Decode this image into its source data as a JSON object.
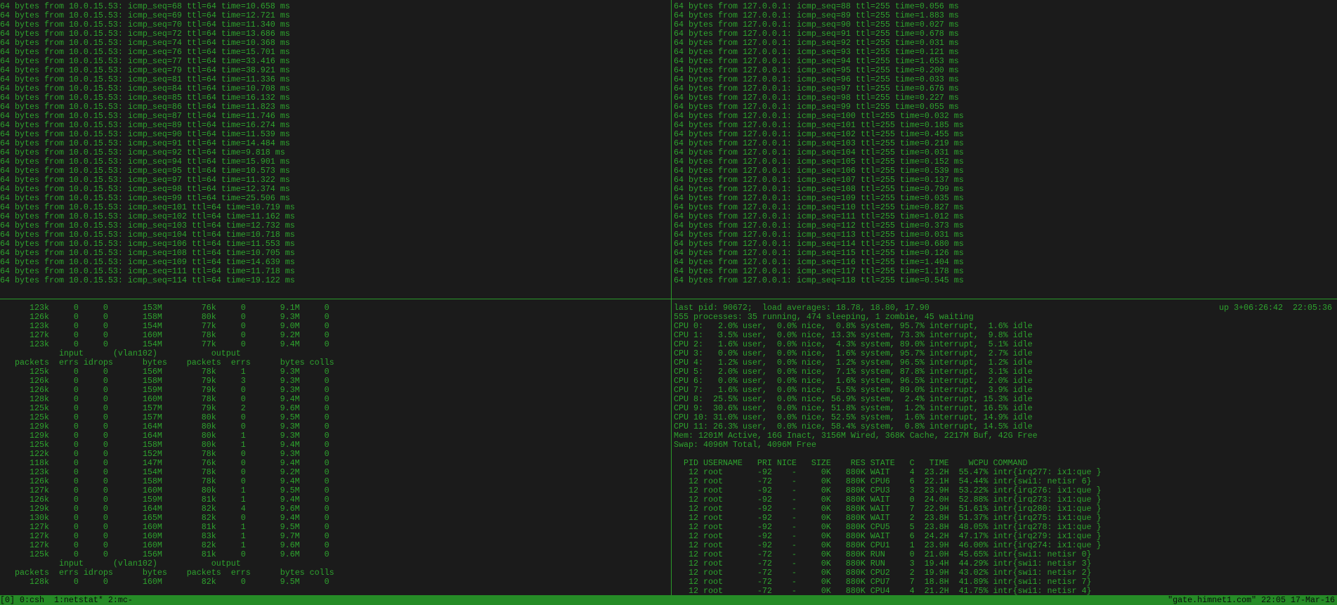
{
  "colors": {
    "text": "#2ea32e",
    "status_bar": "#268c27",
    "background": "#1b1b1b"
  },
  "ping_remote": {
    "host": "10.0.15.53",
    "ttl": "64",
    "lines": [
      [
        "68",
        "10.658"
      ],
      [
        "69",
        "12.721"
      ],
      [
        "70",
        "11.340"
      ],
      [
        "72",
        "13.686"
      ],
      [
        "74",
        "10.368"
      ],
      [
        "76",
        "15.701"
      ],
      [
        "77",
        "33.416"
      ],
      [
        "79",
        "38.921"
      ],
      [
        "81",
        "11.336"
      ],
      [
        "84",
        "10.708"
      ],
      [
        "85",
        "16.132"
      ],
      [
        "86",
        "11.823"
      ],
      [
        "87",
        "11.746"
      ],
      [
        "89",
        "16.274"
      ],
      [
        "90",
        "11.539"
      ],
      [
        "91",
        "14.484"
      ],
      [
        "92",
        "9.818"
      ],
      [
        "94",
        "15.901"
      ],
      [
        "95",
        "10.573"
      ],
      [
        "97",
        "11.322"
      ],
      [
        "98",
        "12.374"
      ],
      [
        "99",
        "25.506"
      ],
      [
        "101",
        "10.719"
      ],
      [
        "102",
        "11.162"
      ],
      [
        "103",
        "12.732"
      ],
      [
        "104",
        "10.718"
      ],
      [
        "106",
        "11.553"
      ],
      [
        "108",
        "10.705"
      ],
      [
        "109",
        "14.639"
      ],
      [
        "111",
        "11.718"
      ],
      [
        "114",
        "19.122"
      ]
    ]
  },
  "ping_local": {
    "host": "127.0.0.1",
    "ttl": "255",
    "lines": [
      [
        "88",
        "0.056"
      ],
      [
        "89",
        "1.883"
      ],
      [
        "90",
        "0.027"
      ],
      [
        "91",
        "0.678"
      ],
      [
        "92",
        "0.031"
      ],
      [
        "93",
        "0.121"
      ],
      [
        "94",
        "1.653"
      ],
      [
        "95",
        "0.200"
      ],
      [
        "96",
        "0.033"
      ],
      [
        "97",
        "0.676"
      ],
      [
        "98",
        "0.227"
      ],
      [
        "99",
        "0.055"
      ],
      [
        "100",
        "0.032"
      ],
      [
        "101",
        "0.185"
      ],
      [
        "102",
        "0.455"
      ],
      [
        "103",
        "0.219"
      ],
      [
        "104",
        "0.031"
      ],
      [
        "105",
        "0.152"
      ],
      [
        "106",
        "0.539"
      ],
      [
        "107",
        "0.137"
      ],
      [
        "108",
        "0.799"
      ],
      [
        "109",
        "0.035"
      ],
      [
        "110",
        "0.827"
      ],
      [
        "111",
        "1.012"
      ],
      [
        "112",
        "0.373"
      ],
      [
        "113",
        "0.031"
      ],
      [
        "114",
        "0.680"
      ],
      [
        "115",
        "0.126"
      ],
      [
        "116",
        "1.404"
      ],
      [
        "117",
        "1.178"
      ],
      [
        "118",
        "0.545"
      ]
    ]
  },
  "netstat": {
    "header1": {
      "input": "input",
      "iface": "(vlan102)",
      "output": "output"
    },
    "header2": [
      "packets",
      "errs",
      "idrops",
      "bytes",
      "packets",
      "errs",
      "bytes",
      "colls"
    ],
    "blocks": [
      [
        [
          "123k",
          "0",
          "0",
          "153M",
          "76k",
          "0",
          "9.1M",
          "0"
        ],
        [
          "126k",
          "0",
          "0",
          "158M",
          "80k",
          "0",
          "9.3M",
          "0"
        ],
        [
          "123k",
          "0",
          "0",
          "154M",
          "77k",
          "0",
          "9.0M",
          "0"
        ],
        [
          "127k",
          "0",
          "0",
          "160M",
          "78k",
          "0",
          "9.2M",
          "0"
        ],
        [
          "123k",
          "0",
          "0",
          "154M",
          "77k",
          "0",
          "9.4M",
          "0"
        ]
      ],
      [
        [
          "125k",
          "0",
          "0",
          "156M",
          "78k",
          "1",
          "9.3M",
          "0"
        ],
        [
          "126k",
          "0",
          "0",
          "158M",
          "79k",
          "3",
          "9.3M",
          "0"
        ],
        [
          "126k",
          "0",
          "0",
          "159M",
          "79k",
          "0",
          "9.3M",
          "0"
        ],
        [
          "128k",
          "0",
          "0",
          "160M",
          "78k",
          "0",
          "9.4M",
          "0"
        ],
        [
          "125k",
          "0",
          "0",
          "157M",
          "79k",
          "2",
          "9.6M",
          "0"
        ],
        [
          "125k",
          "0",
          "0",
          "157M",
          "80k",
          "0",
          "9.5M",
          "0"
        ],
        [
          "129k",
          "0",
          "0",
          "164M",
          "80k",
          "0",
          "9.3M",
          "0"
        ],
        [
          "129k",
          "0",
          "0",
          "164M",
          "80k",
          "1",
          "9.3M",
          "0"
        ],
        [
          "125k",
          "0",
          "0",
          "158M",
          "80k",
          "1",
          "9.4M",
          "0"
        ],
        [
          "122k",
          "0",
          "0",
          "152M",
          "78k",
          "0",
          "9.3M",
          "0"
        ],
        [
          "118k",
          "0",
          "0",
          "147M",
          "76k",
          "0",
          "9.4M",
          "0"
        ],
        [
          "123k",
          "0",
          "0",
          "154M",
          "78k",
          "0",
          "9.2M",
          "0"
        ],
        [
          "126k",
          "0",
          "0",
          "158M",
          "78k",
          "0",
          "9.4M",
          "0"
        ],
        [
          "127k",
          "0",
          "0",
          "160M",
          "80k",
          "1",
          "9.5M",
          "0"
        ],
        [
          "126k",
          "0",
          "0",
          "159M",
          "81k",
          "1",
          "9.4M",
          "0"
        ],
        [
          "129k",
          "0",
          "0",
          "164M",
          "82k",
          "4",
          "9.6M",
          "0"
        ],
        [
          "130k",
          "0",
          "0",
          "165M",
          "82k",
          "0",
          "9.4M",
          "0"
        ],
        [
          "127k",
          "0",
          "0",
          "160M",
          "81k",
          "1",
          "9.5M",
          "0"
        ],
        [
          "127k",
          "0",
          "0",
          "160M",
          "83k",
          "1",
          "9.7M",
          "0"
        ],
        [
          "127k",
          "0",
          "0",
          "160M",
          "82k",
          "1",
          "9.6M",
          "0"
        ],
        [
          "125k",
          "0",
          "0",
          "156M",
          "81k",
          "0",
          "9.6M",
          "0"
        ]
      ],
      [
        [
          "128k",
          "0",
          "0",
          "160M",
          "82k",
          "0",
          "9.5M",
          "0"
        ]
      ]
    ]
  },
  "top": {
    "last_pid_line": "last pid: 90672;  load averages: 18.78, 18.80, 17.90",
    "uptime": "up 3+06:26:42  22:05:36",
    "processes_line": "555 processes: 35 running, 474 sleeping, 1 zombie, 45 waiting",
    "cpu_lines": [
      "CPU 0:   2.0% user,  0.0% nice,  0.8% system, 95.7% interrupt,  1.6% idle",
      "CPU 1:   3.5% user,  0.0% nice, 13.3% system, 73.3% interrupt,  9.8% idle",
      "CPU 2:   1.6% user,  0.0% nice,  4.3% system, 89.0% interrupt,  5.1% idle",
      "CPU 3:   0.0% user,  0.0% nice,  1.6% system, 95.7% interrupt,  2.7% idle",
      "CPU 4:   1.2% user,  0.0% nice,  1.2% system, 96.5% interrupt,  1.2% idle",
      "CPU 5:   2.0% user,  0.0% nice,  7.1% system, 87.8% interrupt,  3.1% idle",
      "CPU 6:   0.0% user,  0.0% nice,  1.6% system, 96.5% interrupt,  2.0% idle",
      "CPU 7:   1.6% user,  0.0% nice,  5.5% system, 89.0% interrupt,  3.9% idle",
      "CPU 8:  25.5% user,  0.0% nice, 56.9% system,  2.4% interrupt, 15.3% idle",
      "CPU 9:  30.6% user,  0.0% nice, 51.8% system,  1.2% interrupt, 16.5% idle",
      "CPU 10: 31.0% user,  0.0% nice, 52.5% system,  1.6% interrupt, 14.9% idle",
      "CPU 11: 26.3% user,  0.0% nice, 58.4% system,  0.8% interrupt, 14.5% idle"
    ],
    "mem_line": "Mem: 1201M Active, 16G Inact, 3156M Wired, 368K Cache, 2217M Buf, 42G Free",
    "swap_line": "Swap: 4096M Total, 4096M Free",
    "columns": [
      "PID",
      "USERNAME",
      "PRI",
      "NICE",
      "SIZE",
      "RES",
      "STATE",
      "C",
      "TIME",
      "WCPU",
      "COMMAND"
    ],
    "rows": [
      [
        "12",
        "root",
        "-92",
        "-",
        "0K",
        "880K",
        "WAIT",
        "4",
        "23.2H",
        "55.47%",
        "intr{irq277: ix1:que }"
      ],
      [
        "12",
        "root",
        "-72",
        "-",
        "0K",
        "880K",
        "CPU6",
        "6",
        "22.1H",
        "54.44%",
        "intr{swi1: netisr 6}"
      ],
      [
        "12",
        "root",
        "-92",
        "-",
        "0K",
        "880K",
        "CPU3",
        "3",
        "23.9H",
        "53.22%",
        "intr{irq276: ix1:que }"
      ],
      [
        "12",
        "root",
        "-92",
        "-",
        "0K",
        "880K",
        "WAIT",
        "0",
        "24.0H",
        "52.88%",
        "intr{irq273: ix1:que }"
      ],
      [
        "12",
        "root",
        "-92",
        "-",
        "0K",
        "880K",
        "WAIT",
        "7",
        "22.9H",
        "51.61%",
        "intr{irq280: ix1:que }"
      ],
      [
        "12",
        "root",
        "-92",
        "-",
        "0K",
        "880K",
        "WAIT",
        "2",
        "23.8H",
        "51.37%",
        "intr{irq275: ix1:que }"
      ],
      [
        "12",
        "root",
        "-92",
        "-",
        "0K",
        "880K",
        "CPU5",
        "5",
        "23.8H",
        "48.05%",
        "intr{irq278: ix1:que }"
      ],
      [
        "12",
        "root",
        "-92",
        "-",
        "0K",
        "880K",
        "WAIT",
        "6",
        "24.2H",
        "47.17%",
        "intr{irq279: ix1:que }"
      ],
      [
        "12",
        "root",
        "-92",
        "-",
        "0K",
        "880K",
        "CPU1",
        "1",
        "23.9H",
        "46.00%",
        "intr{irq274: ix1:que }"
      ],
      [
        "12",
        "root",
        "-72",
        "-",
        "0K",
        "880K",
        "RUN",
        "0",
        "21.0H",
        "45.65%",
        "intr{swi1: netisr 0}"
      ],
      [
        "12",
        "root",
        "-72",
        "-",
        "0K",
        "880K",
        "RUN",
        "3",
        "19.4H",
        "44.29%",
        "intr{swi1: netisr 3}"
      ],
      [
        "12",
        "root",
        "-72",
        "-",
        "0K",
        "880K",
        "CPU2",
        "2",
        "19.9H",
        "43.02%",
        "intr{swi1: netisr 2}"
      ],
      [
        "12",
        "root",
        "-72",
        "-",
        "0K",
        "880K",
        "CPU7",
        "7",
        "18.8H",
        "41.89%",
        "intr{swi1: netisr 7}"
      ],
      [
        "12",
        "root",
        "-72",
        "-",
        "0K",
        "880K",
        "CPU4",
        "4",
        "21.2H",
        "41.75%",
        "intr{swi1: netisr 4}"
      ]
    ]
  },
  "status_bar": {
    "windows": "[0] 0:csh  1:netstat* 2:mc-",
    "right": "\"gate.himnet1.com\" 22:05 17-Mar-16"
  }
}
